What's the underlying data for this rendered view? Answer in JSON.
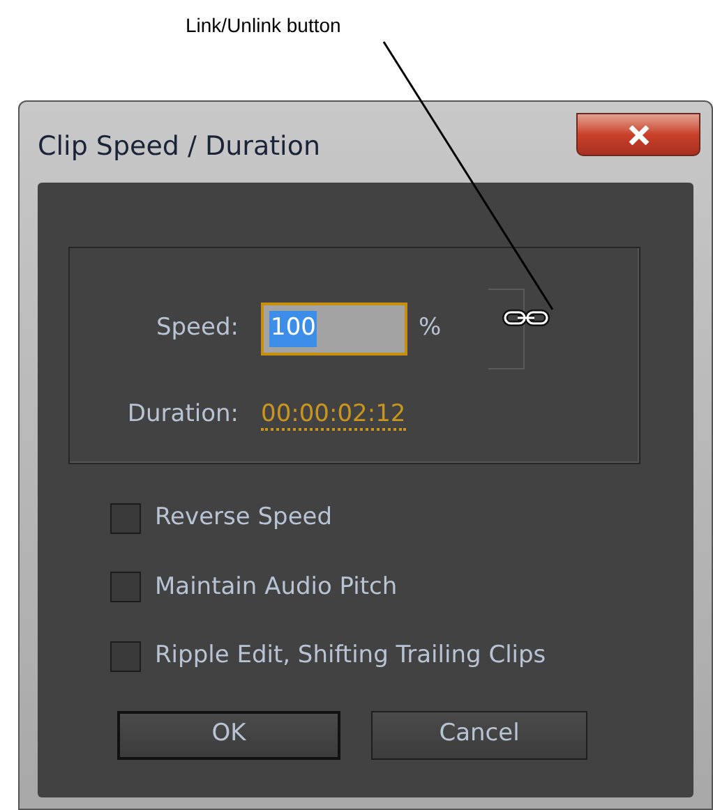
{
  "annotation": {
    "label": "Link/Unlink button"
  },
  "window": {
    "title": "Clip Speed / Duration"
  },
  "speed": {
    "label": "Speed:",
    "value": "100",
    "unit": "%",
    "selected": true
  },
  "link": {
    "linked": true
  },
  "duration": {
    "label": "Duration:",
    "value": "00:00:02:12"
  },
  "options": [
    {
      "label": "Reverse Speed",
      "checked": false
    },
    {
      "label": "Maintain Audio Pitch",
      "checked": false
    },
    {
      "label": "Ripple Edit, Shifting Trailing Clips",
      "checked": false
    }
  ],
  "buttons": [
    {
      "label": "OK",
      "default": true
    },
    {
      "label": "Cancel",
      "default": false
    }
  ]
}
